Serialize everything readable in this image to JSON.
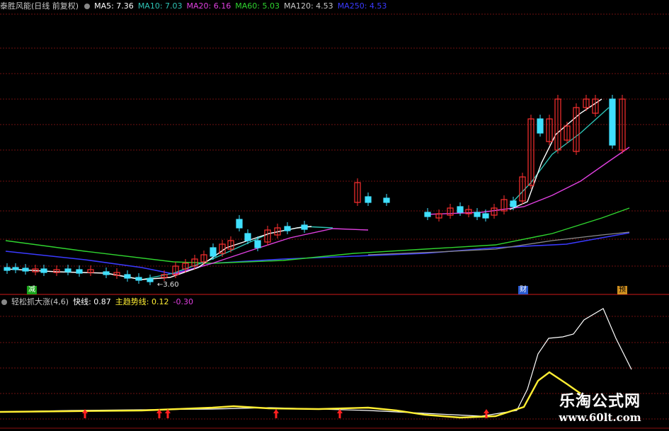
{
  "main_header": {
    "stock_name": "泰胜风能(日线 前复权)",
    "ma5": "MA5: 7.36",
    "ma10": "MA10: 7.03",
    "ma20": "MA20: 6.16",
    "ma60": "MA60: 5.03",
    "ma120": "MA120: 4.53",
    "ma250": "MA250: 4.53"
  },
  "sub_header": {
    "indicator": "轻松抓大涨(4,6)",
    "fast_line": "快线: 0.87",
    "trend_line": "主趋势线: 0.12",
    "diff": "-0.30"
  },
  "annotations": {
    "low_price": "3.60",
    "badge_reduce": "减",
    "badge_finance": "财",
    "badge_report": "预"
  },
  "watermark": {
    "brand": "乐淘公式网",
    "url": "www.60lt.com"
  },
  "colors": {
    "background": "#000000",
    "grid": "#6e1010",
    "ma5": "#ffffff",
    "ma10": "#2ec4b6",
    "ma20": "#e040e0",
    "ma60": "#2fd42f",
    "ma120": "#8a8a8a",
    "ma250": "#3a3aff",
    "up_candle": "#ff3030",
    "down_candle": "#40e0ff",
    "fast_line": "#ffffff",
    "trend_line": "#ffee33",
    "signal_arrow": "#ff2020"
  },
  "chart_data": [
    {
      "type": "candlestick",
      "title": "泰胜风能(日线 前复权)",
      "series": [
        {
          "name": "MA5",
          "value": 7.36
        },
        {
          "name": "MA10",
          "value": 7.03
        },
        {
          "name": "MA20",
          "value": 6.16
        },
        {
          "name": "MA60",
          "value": 5.03
        },
        {
          "name": "MA120",
          "value": 4.53
        },
        {
          "name": "MA250",
          "value": 4.53
        }
      ],
      "annotations": [
        "3.60"
      ],
      "grid": true
    },
    {
      "type": "line",
      "title": "轻松抓大涨(4,6)",
      "series": [
        {
          "name": "快线",
          "value": 0.87
        },
        {
          "name": "主趋势线",
          "value": 0.12
        }
      ],
      "signal_count": 6
    }
  ]
}
